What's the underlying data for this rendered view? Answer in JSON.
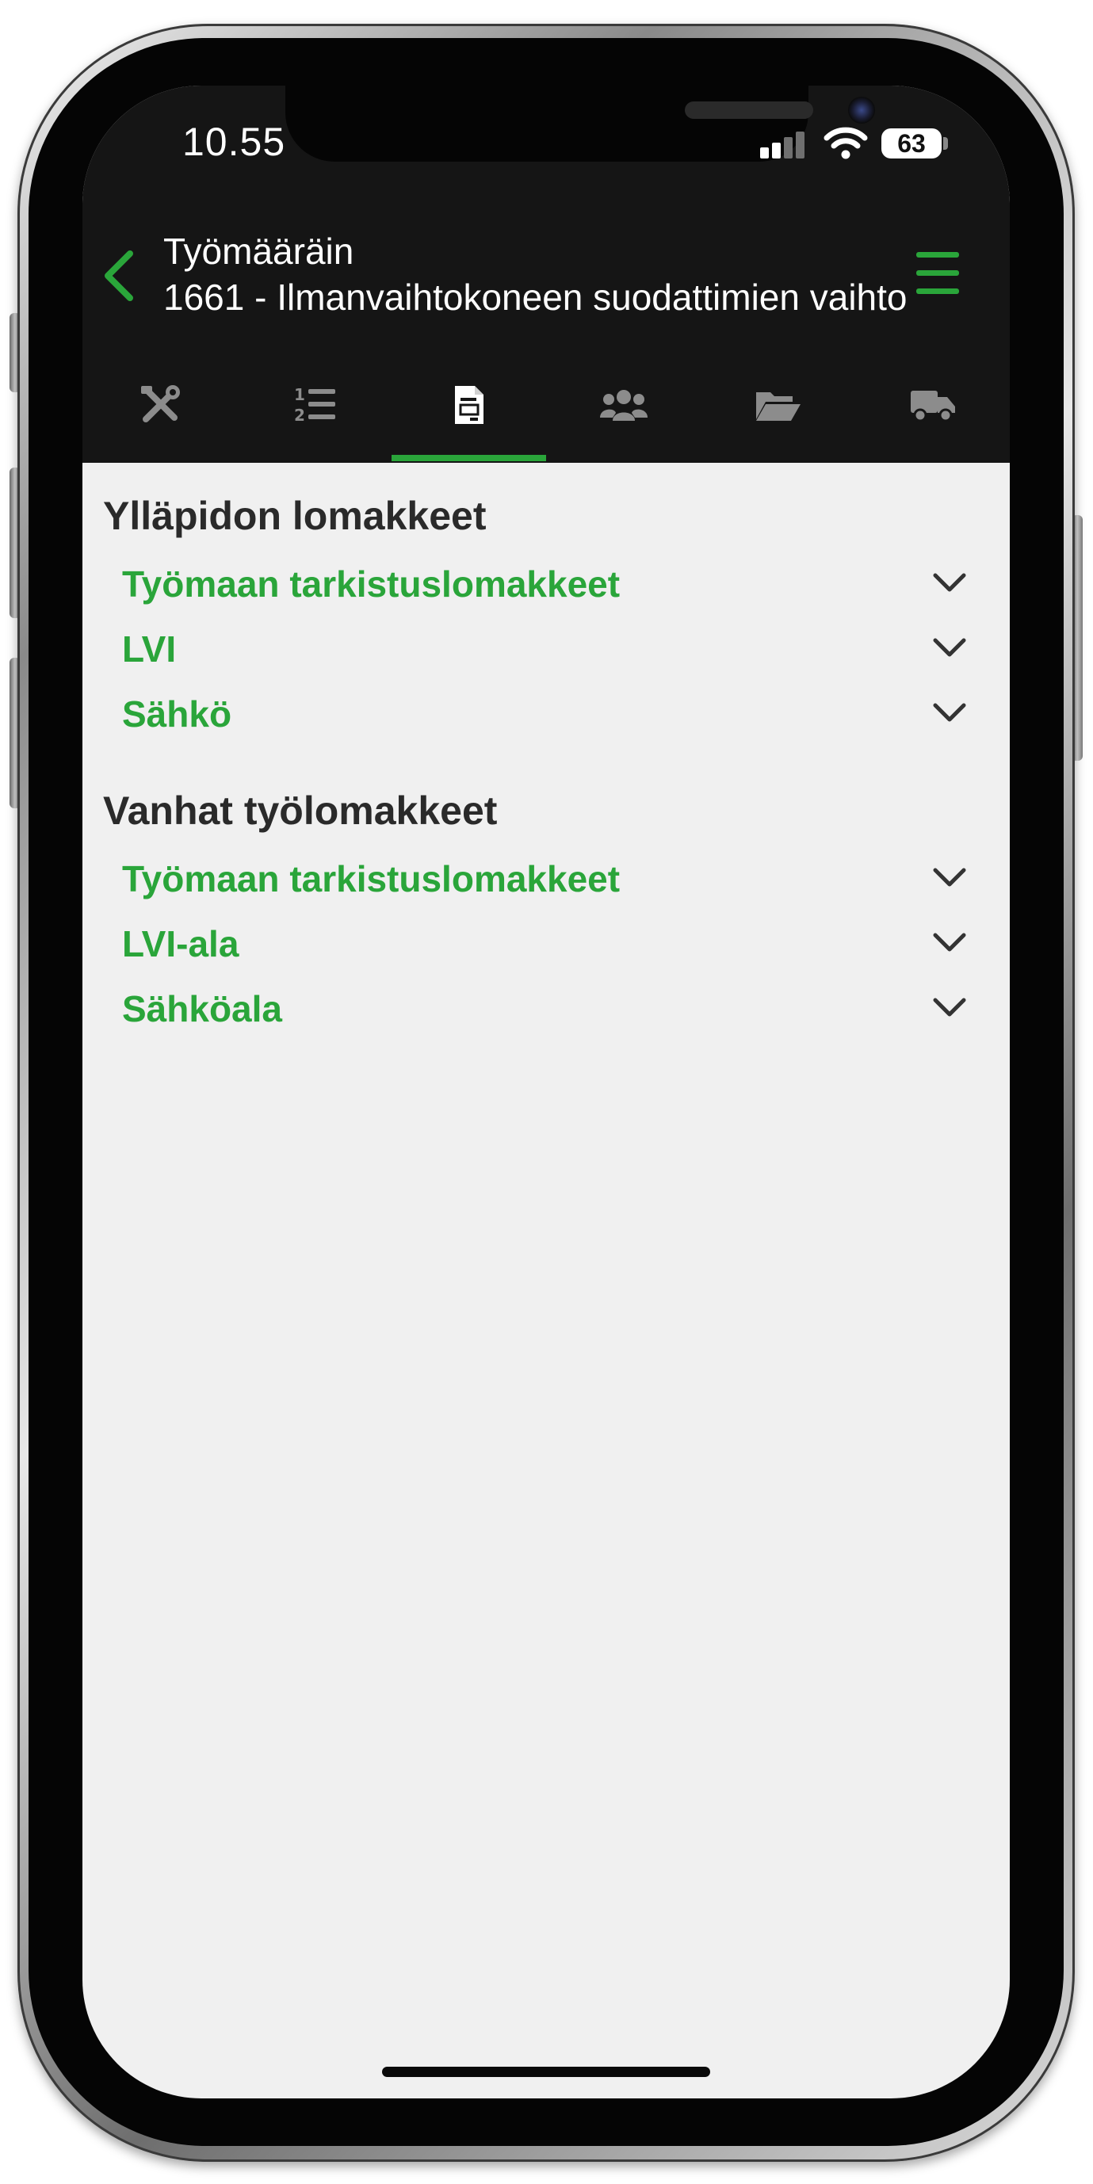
{
  "status_bar": {
    "time": "10.55",
    "battery": "63"
  },
  "header": {
    "subtitle": "Työmääräin",
    "title": "1661 - Ilmanvaihtokoneen suodattimien vaihto",
    "accent_color": "#2aa53a"
  },
  "tabs": [
    {
      "icon": "tools-icon",
      "active": false
    },
    {
      "icon": "numbered-list-icon",
      "active": false
    },
    {
      "icon": "document-icon",
      "active": true
    },
    {
      "icon": "users-icon",
      "active": false
    },
    {
      "icon": "folder-open-icon",
      "active": false
    },
    {
      "icon": "truck-icon",
      "active": false
    }
  ],
  "sections": [
    {
      "title": "Ylläpidon lomakkeet",
      "items": [
        {
          "label": "Työmaan tarkistuslomakkeet"
        },
        {
          "label": "LVI"
        },
        {
          "label": "Sähkö"
        }
      ]
    },
    {
      "title": "Vanhat työlomakkeet",
      "items": [
        {
          "label": "Työmaan tarkistuslomakkeet"
        },
        {
          "label": "LVI-ala"
        },
        {
          "label": "Sähköala"
        }
      ]
    }
  ]
}
